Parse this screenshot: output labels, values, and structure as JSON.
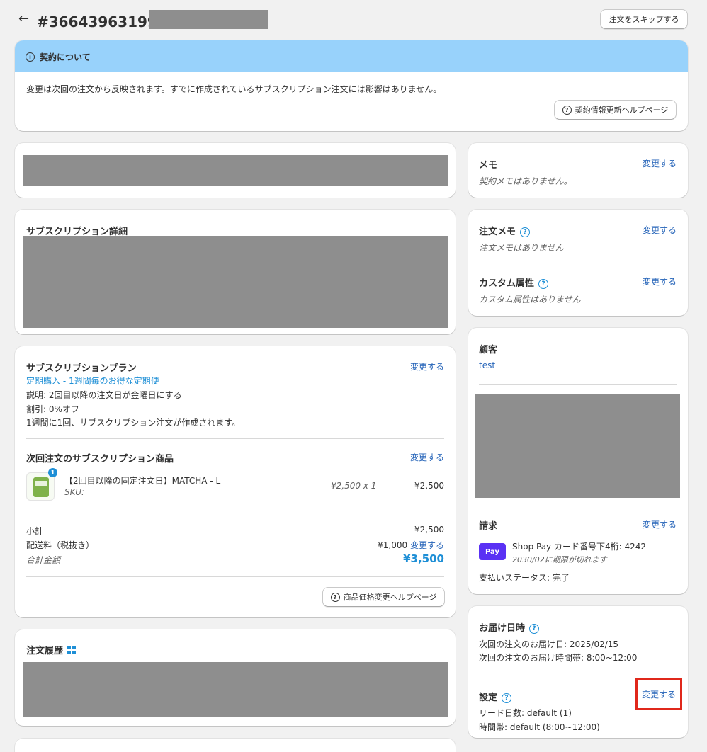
{
  "header": {
    "back_icon": "arrow-left-icon",
    "title": "#36643963199",
    "skip_button": "注文をスキップする"
  },
  "banner": {
    "icon": "info-icon",
    "title": "契約について",
    "message": "変更は次回の注文から反映されます。すでに作成されているサブスクリプション注文には影響はありません。",
    "help_button": "契約情報更新ヘルプページ"
  },
  "subscription_detail": {
    "title": "サブスクリプション詳細"
  },
  "plan": {
    "title": "サブスクリプションプラン",
    "change": "変更する",
    "plan_name": "定期購入 - 1週間毎のお得な定期便",
    "description": "説明: 2回目以降の注文日が金曜日にする",
    "discount": "割引: 0%オフ",
    "frequency": "1週間に1回、サブスクリプション注文が作成されます。"
  },
  "next_order": {
    "title": "次回注文のサブスクリプション商品",
    "change": "変更する",
    "product_name": "【2回目以降の固定注文日】MATCHA - L",
    "sku": "SKU:",
    "unit_price": "¥2,500 x 1",
    "line_total": "¥2,500",
    "qty_badge": "1",
    "subtotal_label": "小計",
    "subtotal_value": "¥2,500",
    "shipping_label": "配送料（税抜き）",
    "shipping_value": "¥1,000",
    "shipping_change": "変更する",
    "total_label": "合計金額",
    "total_value": "¥3,500",
    "help_button": "商品価格変更ヘルプページ"
  },
  "order_history": {
    "title": "注文履歴"
  },
  "memo": {
    "title": "メモ",
    "change": "変更する",
    "empty": "契約メモはありません。"
  },
  "order_memo": {
    "title": "注文メモ",
    "change": "変更する",
    "empty": "注文メモはありません"
  },
  "custom_attr": {
    "title": "カスタム属性",
    "change": "変更する",
    "empty": "カスタム属性はありません"
  },
  "customer": {
    "title": "顧客",
    "name": "test"
  },
  "billing": {
    "title": "請求",
    "change": "変更する",
    "pay_logo": "Pay",
    "card": "Shop Pay カード番号下4桁: 4242",
    "expiry": "2030/02に期限が切れます",
    "status": "支払いステータス: 完了"
  },
  "delivery": {
    "title": "お届け日時",
    "next_date": "次回の注文のお届け日: 2025/02/15",
    "next_time": "次回の注文のお届け時間帯: 8:00~12:00",
    "settings_title": "設定",
    "change": "変更する",
    "lead_days": "リード日数: default (1)",
    "time_slot": "時間帯: default (8:00~12:00)"
  },
  "colors": {
    "banner_bg": "#98d2fb",
    "link": "#2463b8",
    "accent_blue": "#1e8fd6",
    "highlight_red": "#e0281b",
    "shop_pay": "#5a31f4"
  }
}
